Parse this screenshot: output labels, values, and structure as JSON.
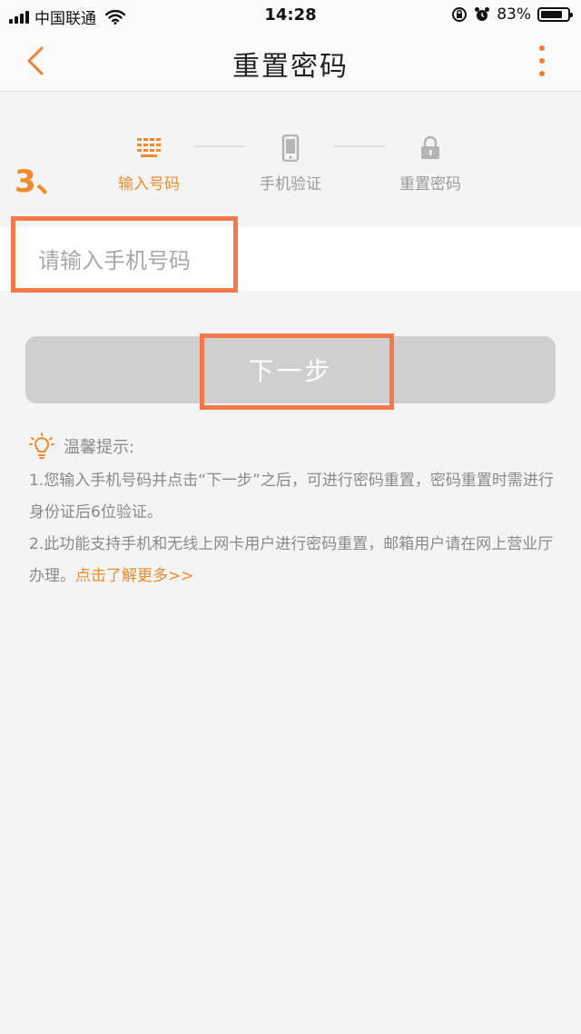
{
  "status": {
    "carrier": "中国联通",
    "time": "14:28",
    "battery": "83%",
    "battery_level": 0.83
  },
  "nav": {
    "title": "重置密码",
    "back_icon": "chevron-left-icon",
    "more_icon": "more-vertical-icon"
  },
  "annotation": {
    "step_number": "3、"
  },
  "steps": [
    {
      "label": "输入号码",
      "icon": "keypad-icon",
      "state": "active"
    },
    {
      "label": "手机验证",
      "icon": "phone-icon",
      "state": "inactive"
    },
    {
      "label": "重置密码",
      "icon": "lock-icon",
      "state": "inactive"
    }
  ],
  "form": {
    "phone_placeholder": "请输入手机号码",
    "phone_value": "",
    "next_label": "下一步"
  },
  "tips": {
    "title": "温馨提示:",
    "line1": "1.您输入手机号码并点击“下一步”之后，可进行密码重置，密码重置时需进行身份证后6位验证。",
    "line2": "2.此功能支持手机和无线上网卡用户进行密码重置，邮箱用户请在网上营业厅办理。",
    "link": "点击了解更多>>"
  },
  "colors": {
    "accent": "#f08a2a",
    "highlight": "#f2794a",
    "button_disabled": "#cfcfcf",
    "background": "#f4f4f4"
  }
}
